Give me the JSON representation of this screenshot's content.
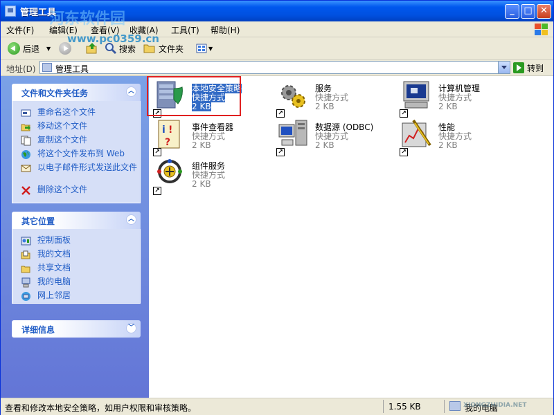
{
  "window": {
    "title": "管理工具"
  },
  "menu": [
    "文件(F)",
    "编辑(E)",
    "查看(V)",
    "收藏(A)",
    "工具(T)",
    "帮助(H)"
  ],
  "toolbar": {
    "back": "后退",
    "search": "搜索",
    "folders": "文件夹"
  },
  "address": {
    "label": "地址(D)",
    "value": "管理工具",
    "go": "转到"
  },
  "sidebar": {
    "tasks": {
      "title": "文件和文件夹任务",
      "items": [
        "重命名这个文件",
        "移动这个文件",
        "复制这个文件",
        "将这个文件发布到 Web",
        "以电子邮件形式发送此文件",
        "删除这个文件"
      ]
    },
    "places": {
      "title": "其它位置",
      "items": [
        "控制面板",
        "我的文档",
        "共享文档",
        "我的电脑",
        "网上邻居"
      ]
    },
    "details": {
      "title": "详细信息"
    }
  },
  "files": [
    {
      "name": "本地安全策略",
      "type": "快捷方式",
      "size": "2 KB"
    },
    {
      "name": "服务",
      "type": "快捷方式",
      "size": "2 KB"
    },
    {
      "name": "计算机管理",
      "type": "快捷方式",
      "size": "2 KB"
    },
    {
      "name": "事件查看器",
      "type": "快捷方式",
      "size": "2 KB"
    },
    {
      "name": "数据源 (ODBC)",
      "type": "快捷方式",
      "size": "2 KB"
    },
    {
      "name": "性能",
      "type": "快捷方式",
      "size": "2 KB"
    },
    {
      "name": "组件服务",
      "type": "快捷方式",
      "size": "2 KB"
    }
  ],
  "status": {
    "text": "查看和修改本地安全策略，如用户权限和审核策略。",
    "size": "1.55 KB",
    "zone": "我的电脑"
  },
  "watermarks": {
    "top": "河东软件园",
    "url": "www.pc0359.cn",
    "bottom": "XIONGZHIDIA.NET"
  }
}
